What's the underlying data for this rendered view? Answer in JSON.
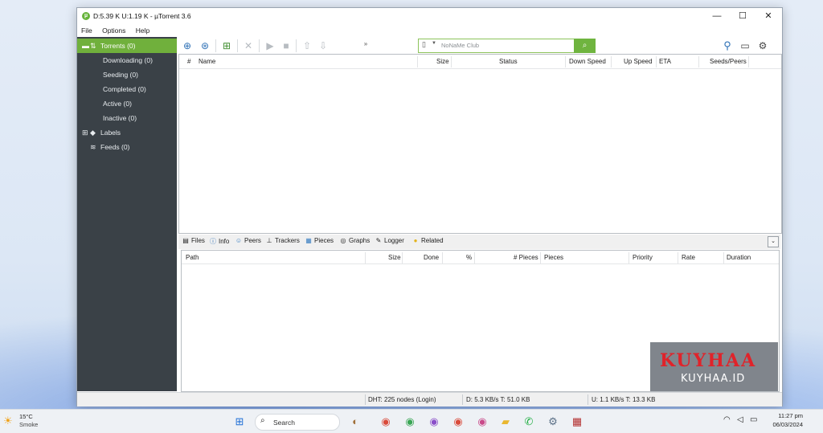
{
  "window": {
    "title": "D:5.39 K U:1.19 K - µTorrent 3.6",
    "logo_glyph": "µ",
    "controls": {
      "minimize": "—",
      "maximize": "☐",
      "close": "✕"
    }
  },
  "menu": [
    "File",
    "Options",
    "Help"
  ],
  "sidebar": {
    "torrents": "Torrents (0)",
    "items": [
      "Downloading (0)",
      "Seeding (0)",
      "Completed (0)",
      "Active (0)",
      "Inactive (0)"
    ],
    "labels": "Labels",
    "feeds": "Feeds (0)"
  },
  "toolbar": {
    "overflow": "»",
    "search_placeholder": "NoNaMe Club",
    "icons": [
      "add-url-icon",
      "add-rss-icon",
      "create-torrent-icon",
      "remove-icon",
      "start-icon",
      "stop-icon",
      "move-up-icon",
      "move-down-icon",
      "search-icon",
      "remote-icon",
      "preferences-icon"
    ]
  },
  "torrent_list": {
    "columns": [
      "#",
      "Name",
      "Size",
      "Status",
      "Down Speed",
      "Up Speed",
      "ETA",
      "Seeds/Peers"
    ]
  },
  "detail_tabs": [
    "Files",
    "Info",
    "Peers",
    "Trackers",
    "Pieces",
    "Graphs",
    "Logger",
    "Related"
  ],
  "files_table": {
    "columns": [
      "Path",
      "Size",
      "Done",
      "%",
      "# Pieces",
      "Pieces",
      "Priority",
      "Rate",
      "Duration"
    ]
  },
  "status": {
    "dht": "DHT: 225 nodes (Login)",
    "download": "D: 5.3 KB/s T: 51.0 KB",
    "upload": "U: 1.1 KB/s T: 13.3 KB"
  },
  "watermark": {
    "line1": "KUYHAA",
    "line2": "KUYHAA.ID"
  },
  "taskbar": {
    "weather_temp": "15°C",
    "weather_desc": "Smoke",
    "search": "Search",
    "time": "11:27 pm",
    "date": "06/03/2024"
  },
  "colors": {
    "accent_green": "#70b03c",
    "sidebar_bg": "#3a4147",
    "watermark_red": "#e0232a"
  }
}
